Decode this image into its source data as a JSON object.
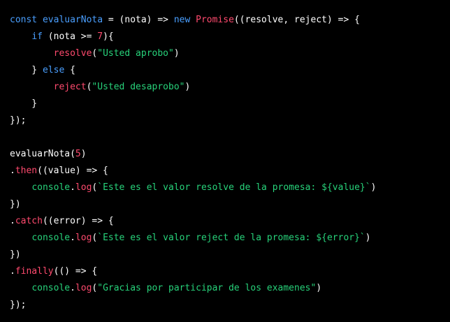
{
  "colors": {
    "background": "#000000",
    "plain": "#ffffff",
    "keyword": "#4a9fff",
    "function": "#ff4a6e",
    "number": "#ff4a6e",
    "string": "#27d27a",
    "global": "#27d27a"
  },
  "code": {
    "lines": [
      {
        "tokens": [
          {
            "t": "kw",
            "v": "const"
          },
          {
            "t": "plain",
            "v": " "
          },
          {
            "t": "kw",
            "v": "evaluarNota"
          },
          {
            "t": "plain",
            "v": " = (nota) => "
          },
          {
            "t": "kw",
            "v": "new"
          },
          {
            "t": "plain",
            "v": " "
          },
          {
            "t": "fn",
            "v": "Promise"
          },
          {
            "t": "plain",
            "v": "((resolve, reject) => {"
          }
        ]
      },
      {
        "tokens": [
          {
            "t": "plain",
            "v": "    "
          },
          {
            "t": "kw",
            "v": "if"
          },
          {
            "t": "plain",
            "v": " (nota >= "
          },
          {
            "t": "num",
            "v": "7"
          },
          {
            "t": "plain",
            "v": "){"
          }
        ]
      },
      {
        "tokens": [
          {
            "t": "plain",
            "v": "        "
          },
          {
            "t": "fn",
            "v": "resolve"
          },
          {
            "t": "plain",
            "v": "("
          },
          {
            "t": "str",
            "v": "\"Usted aprobo\""
          },
          {
            "t": "plain",
            "v": ")"
          }
        ]
      },
      {
        "tokens": [
          {
            "t": "plain",
            "v": "    } "
          },
          {
            "t": "kw",
            "v": "else"
          },
          {
            "t": "plain",
            "v": " {"
          }
        ]
      },
      {
        "tokens": [
          {
            "t": "plain",
            "v": "        "
          },
          {
            "t": "fn",
            "v": "reject"
          },
          {
            "t": "plain",
            "v": "("
          },
          {
            "t": "str",
            "v": "\"Usted desaprobo\""
          },
          {
            "t": "plain",
            "v": ")"
          }
        ]
      },
      {
        "tokens": [
          {
            "t": "plain",
            "v": "    }"
          }
        ]
      },
      {
        "tokens": [
          {
            "t": "plain",
            "v": "});"
          }
        ]
      },
      {
        "tokens": []
      },
      {
        "tokens": [
          {
            "t": "plain",
            "v": "evaluarNota("
          },
          {
            "t": "num",
            "v": "5"
          },
          {
            "t": "plain",
            "v": ")"
          }
        ]
      },
      {
        "tokens": [
          {
            "t": "plain",
            "v": "."
          },
          {
            "t": "fn",
            "v": "then"
          },
          {
            "t": "plain",
            "v": "((value) => {"
          }
        ]
      },
      {
        "tokens": [
          {
            "t": "plain",
            "v": "    "
          },
          {
            "t": "global",
            "v": "console"
          },
          {
            "t": "plain",
            "v": "."
          },
          {
            "t": "fn",
            "v": "log"
          },
          {
            "t": "plain",
            "v": "("
          },
          {
            "t": "str",
            "v": "`Este es el valor resolve de la promesa: ${value}`"
          },
          {
            "t": "plain",
            "v": ")"
          }
        ]
      },
      {
        "tokens": [
          {
            "t": "plain",
            "v": "})"
          }
        ]
      },
      {
        "tokens": [
          {
            "t": "plain",
            "v": "."
          },
          {
            "t": "fn",
            "v": "catch"
          },
          {
            "t": "plain",
            "v": "((error) => {"
          }
        ]
      },
      {
        "tokens": [
          {
            "t": "plain",
            "v": "    "
          },
          {
            "t": "global",
            "v": "console"
          },
          {
            "t": "plain",
            "v": "."
          },
          {
            "t": "fn",
            "v": "log"
          },
          {
            "t": "plain",
            "v": "("
          },
          {
            "t": "str",
            "v": "`Este es el valor reject de la promesa: ${error}`"
          },
          {
            "t": "plain",
            "v": ")"
          }
        ]
      },
      {
        "tokens": [
          {
            "t": "plain",
            "v": "})"
          }
        ]
      },
      {
        "tokens": [
          {
            "t": "plain",
            "v": "."
          },
          {
            "t": "fn",
            "v": "finally"
          },
          {
            "t": "plain",
            "v": "(() => {"
          }
        ]
      },
      {
        "tokens": [
          {
            "t": "plain",
            "v": "    "
          },
          {
            "t": "global",
            "v": "console"
          },
          {
            "t": "plain",
            "v": "."
          },
          {
            "t": "fn",
            "v": "log"
          },
          {
            "t": "plain",
            "v": "("
          },
          {
            "t": "str",
            "v": "\"Gracias por participar de los examenes\""
          },
          {
            "t": "plain",
            "v": ")"
          }
        ]
      },
      {
        "tokens": [
          {
            "t": "plain",
            "v": "});"
          }
        ]
      }
    ]
  }
}
